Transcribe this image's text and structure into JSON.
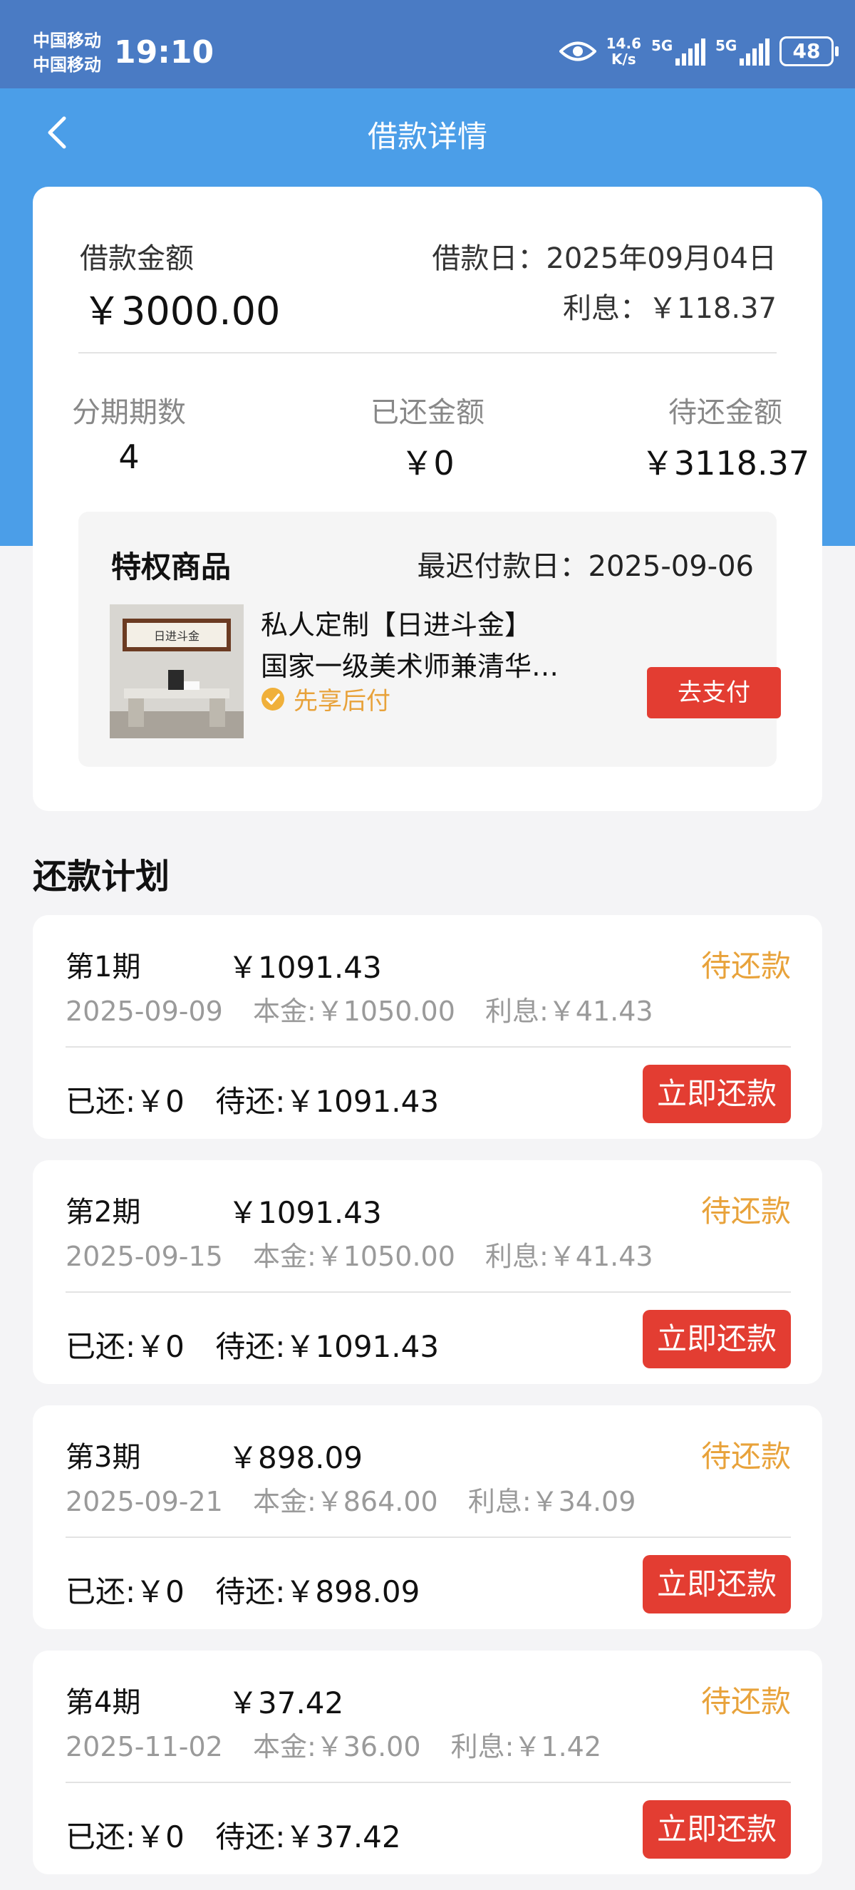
{
  "status_bar": {
    "carrier_1": "中国移动",
    "carrier_2": "中国移动",
    "time": "19:10",
    "net_speed_value": "14.6",
    "net_speed_unit": "K/s",
    "signal_1": "5G",
    "signal_2": "5G",
    "battery": "48"
  },
  "nav": {
    "title": "借款详情",
    "back_icon": "chevron-left-icon"
  },
  "summary": {
    "amount_label": "借款金额",
    "amount": "￥3000.00",
    "loan_date": "借款日：2025年09月04日",
    "interest": "利息：￥118.37",
    "installments_label": "分期期数",
    "installments": "4",
    "paid_label": "已还金额",
    "paid": "￥0",
    "pending_label": "待还金额",
    "pending": "￥3118.37"
  },
  "privilege": {
    "title": "特权商品",
    "deadline": "最迟付款日：2025-09-06",
    "product_line1": "私人定制【日进斗金】",
    "product_line2": "国家一级美术师兼清华美院书法家",
    "tag": "先享后付",
    "pay_button": "去支付",
    "image_caption": "日进斗金"
  },
  "plan": {
    "title": "还款计划",
    "periods": [
      {
        "no": "第1期",
        "amount": "￥1091.43",
        "status": "待还款",
        "date": "2025-09-09",
        "principal": "本金:￥1050.00",
        "interest": "利息:￥41.43",
        "paid": "已还:￥0",
        "pending": "待还:￥1091.43",
        "button": "立即还款"
      },
      {
        "no": "第2期",
        "amount": "￥1091.43",
        "status": "待还款",
        "date": "2025-09-15",
        "principal": "本金:￥1050.00",
        "interest": "利息:￥41.43",
        "paid": "已还:￥0",
        "pending": "待还:￥1091.43",
        "button": "立即还款"
      },
      {
        "no": "第3期",
        "amount": "￥898.09",
        "status": "待还款",
        "date": "2025-09-21",
        "principal": "本金:￥864.00",
        "interest": "利息:￥34.09",
        "paid": "已还:￥0",
        "pending": "待还:￥898.09",
        "button": "立即还款"
      },
      {
        "no": "第4期",
        "amount": "￥37.42",
        "status": "待还款",
        "date": "2025-11-02",
        "principal": "本金:￥36.00",
        "interest": "利息:￥1.42",
        "paid": "已还:￥0",
        "pending": "待还:￥37.42",
        "button": "立即还款"
      }
    ]
  },
  "colors": {
    "status_bar": "#4a7bc4",
    "header_blue": "#4b9ee8",
    "accent_red": "#e33d32",
    "pending_orange": "#e8a23a"
  }
}
